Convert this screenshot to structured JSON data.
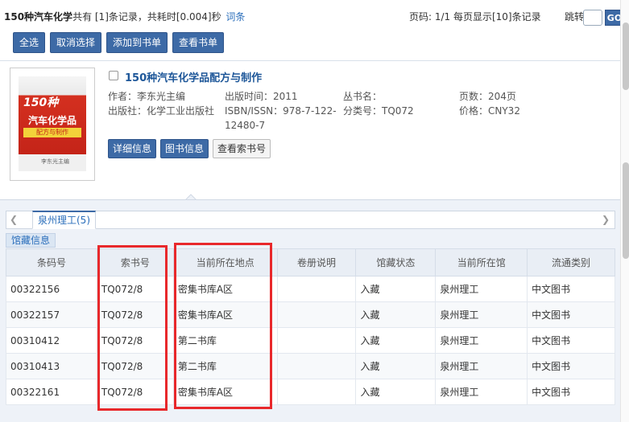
{
  "search": {
    "query": "150种汽车化学",
    "summary": "共有 [1]条记录，共耗时[0.004]秒",
    "link": "词条"
  },
  "pagination": {
    "info": "页码: 1/1 每页显示[10]条记录",
    "jump_label": "跳转",
    "go_label": "GO"
  },
  "toolbar": {
    "select_all": "全选",
    "deselect": "取消选择",
    "add_to_list": "添加到书单",
    "view_list": "查看书单"
  },
  "book": {
    "title": "150种汽车化学品配方与制作",
    "cover": {
      "num": "150种",
      "title": "汽车化学品",
      "sub": "配方与制作",
      "author": "李东光主编"
    },
    "author": "作者：李东光主编",
    "pub_time": "出版时间：2011",
    "series": "丛书名：",
    "pages": "页数：204页",
    "publisher": "出版社：化学工业出版社",
    "isbn": "ISBN/ISSN：978-7-122-12480-7",
    "class_no": "分类号：TQ072",
    "price": "价格：CNY32",
    "btn_detail": "详细信息",
    "btn_lib": "图书信息",
    "btn_callno": "查看索书号"
  },
  "holdings": {
    "tab": "泉州理工(5)",
    "subtab": "馆藏信息",
    "headers": [
      "条码号",
      "索书号",
      "当前所在地点",
      "卷册说明",
      "馆藏状态",
      "当前所在馆",
      "流通类别"
    ],
    "rows": [
      [
        "00322156",
        "TQ072/8",
        "密集书库A区",
        "",
        "入藏",
        "泉州理工",
        "中文图书"
      ],
      [
        "00322157",
        "TQ072/8",
        "密集书库A区",
        "",
        "入藏",
        "泉州理工",
        "中文图书"
      ],
      [
        "00310412",
        "TQ072/8",
        "第二书库",
        "",
        "入藏",
        "泉州理工",
        "中文图书"
      ],
      [
        "00310413",
        "TQ072/8",
        "第二书库",
        "",
        "入藏",
        "泉州理工",
        "中文图书"
      ],
      [
        "00322161",
        "TQ072/8",
        "密集书库A区",
        "",
        "入藏",
        "泉州理工",
        "中文图书"
      ]
    ]
  },
  "colors": {
    "accent": "#3d6aa6",
    "link": "#2a6ebb",
    "highlight": "#e8282b"
  }
}
